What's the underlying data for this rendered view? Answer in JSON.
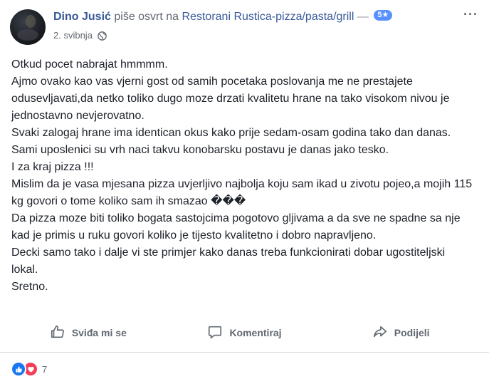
{
  "header": {
    "author": "Dino Jusić",
    "verb": "piše osvrt na",
    "page": "Restorani Rustica-pizza/pasta/grill",
    "dash": "—",
    "rating": "5★",
    "date": "2. svibnja",
    "options_label": "···"
  },
  "review": {
    "lines": [
      "Otkud pocet nabrajat hmmmm.",
      "Ajmo ovako kao vas vjerni gost od samih pocetaka poslovanja me ne prestajete odusevljavati,da netko toliko dugo moze drzati kvalitetu hrane na tako visokom nivou je jednostavno nevjerovatno.",
      "Svaki zalogaj hrane ima identican okus kako prije sedam-osam godina tako dan danas.",
      "Sami uposlenici su vrh naci takvu konobarsku postavu je danas jako tesko.",
      "I za kraj pizza !!!",
      "Mislim da je vasa mjesana pizza uvjerljivo najbolja koju sam ikad u zivotu pojeo,a mojih 115 kg govori o tome koliko sam ih smazao ���",
      "Da pizza moze biti toliko bogata sastojcima pogotovo gljivama a da sve ne spadne sa nje kad je primis u ruku govori koliko je tijesto kvalitetno i dobro napravljeno.",
      "Decki samo tako i dalje vi ste primjer kako danas treba funkcionirati dobar ugostiteljski lokal.",
      "Sretno."
    ]
  },
  "actions": {
    "like": "Sviđa mi se",
    "comment": "Komentiraj",
    "share": "Podijeli"
  },
  "reactions": {
    "count": "7",
    "icons": [
      "like-icon",
      "love-icon"
    ]
  },
  "colors": {
    "link": "#385898",
    "badge": "#5890ff",
    "like": "#1877f2",
    "love": "#f33e58"
  }
}
